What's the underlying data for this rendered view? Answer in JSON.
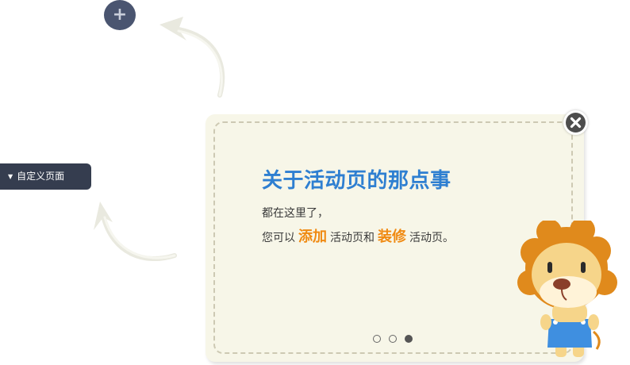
{
  "add_button": {
    "icon": "plus-icon",
    "label": "+"
  },
  "menu": {
    "label": "自定义页面",
    "caret_icon": "caret-down-icon"
  },
  "card": {
    "title": "关于活动页的那点事",
    "line1": "都在这里了，",
    "line2_prefix": "您可以",
    "highlight_add": "添加",
    "line2_mid": "活动页和",
    "highlight_decorate": "装修",
    "line2_suffix": "活动页。",
    "pagination": {
      "total": 3,
      "active": 3
    }
  },
  "colors": {
    "accent_blue": "#2e7fd1",
    "highlight_orange": "#f08a12",
    "card_bg": "#f7f6e8",
    "menu_bg": "#353d4f"
  }
}
